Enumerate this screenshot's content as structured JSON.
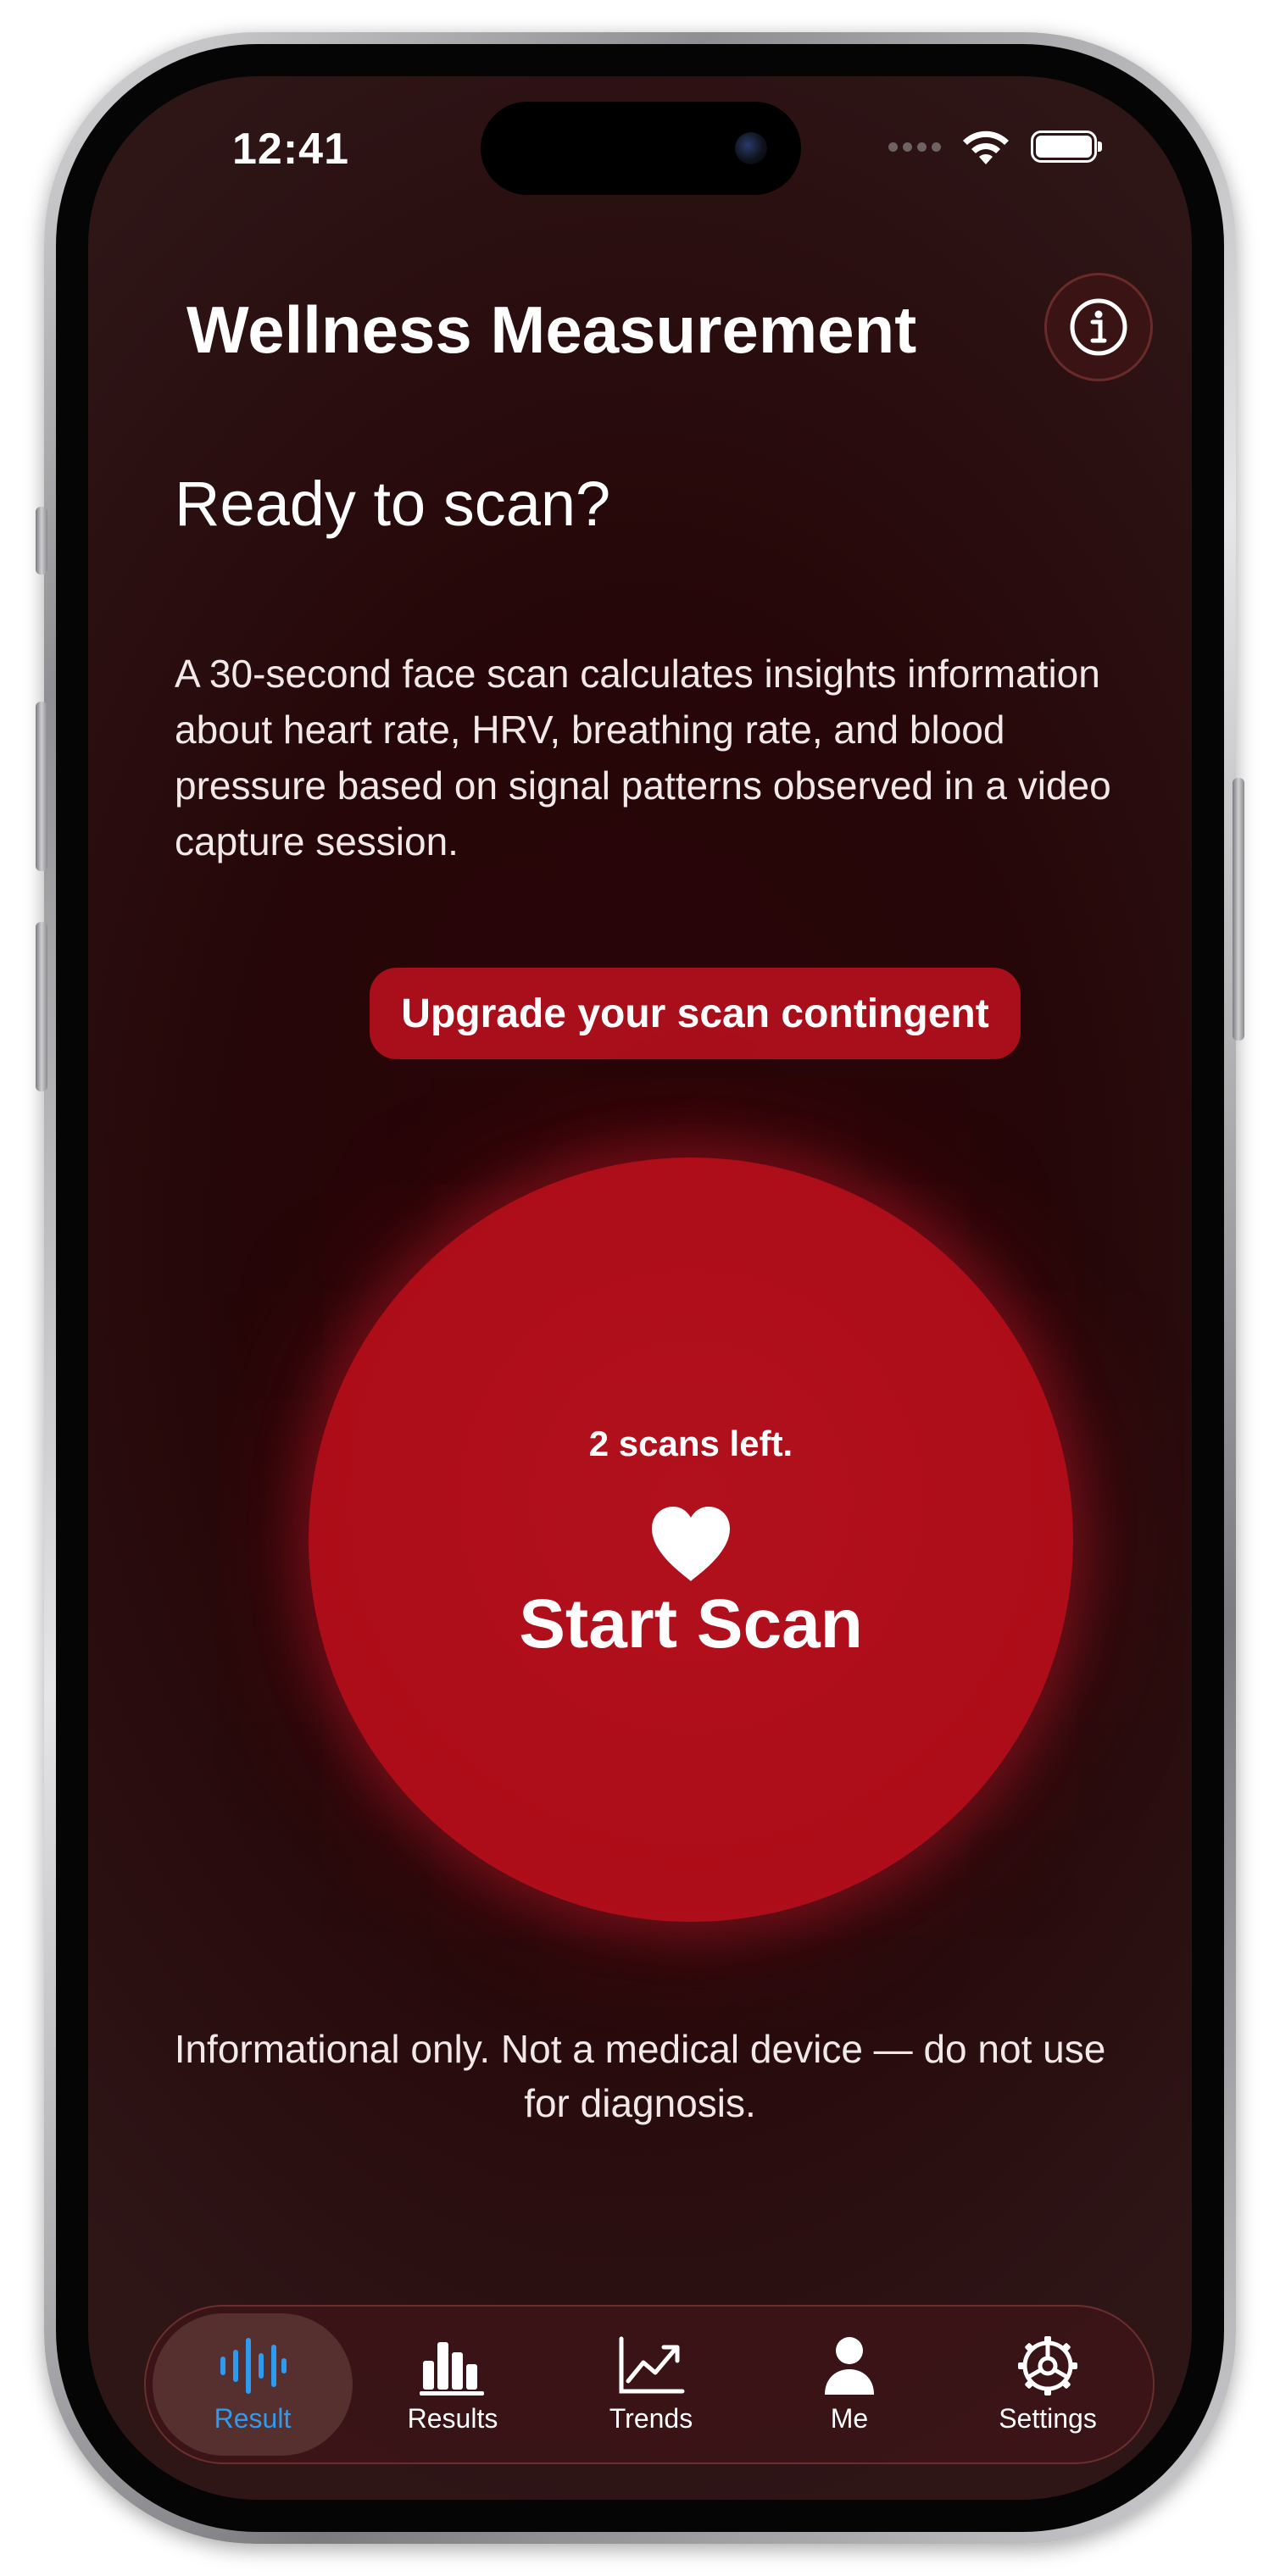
{
  "status_bar": {
    "time": "12:41"
  },
  "header": {
    "title": "Wellness Measurement",
    "info_icon": "info-circle-icon"
  },
  "main": {
    "heading": "Ready to scan?",
    "description": "A 30-second face scan calculates insights information about heart rate, HRV, breathing rate, and blood pressure based on signal patterns observed in a video capture session.",
    "upgrade_label": "Upgrade your scan contingent",
    "scans_left": "2 scans left.",
    "start_label": "Start Scan",
    "start_icon": "heart-icon",
    "disclaimer": "Informational only. Not a medical device — do not use for diagnosis."
  },
  "tabs": [
    {
      "label": "Result",
      "icon": "waveform-icon",
      "active": true
    },
    {
      "label": "Results",
      "icon": "bar-chart-icon",
      "active": false
    },
    {
      "label": "Trends",
      "icon": "trend-chart-icon",
      "active": false
    },
    {
      "label": "Me",
      "icon": "person-icon",
      "active": false
    },
    {
      "label": "Settings",
      "icon": "gear-icon",
      "active": false
    }
  ],
  "colors": {
    "accent_red": "#a90f1b",
    "active_tab_blue": "#2f9bf0",
    "background": "#260608"
  }
}
